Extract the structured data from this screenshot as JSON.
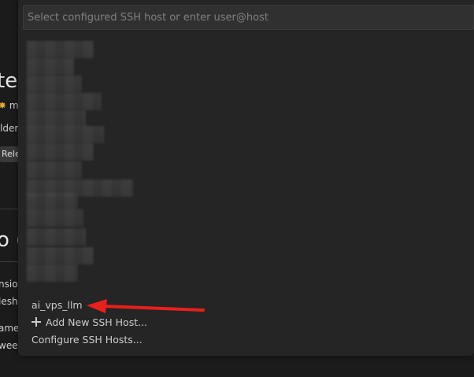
{
  "background": {
    "title_fragment": "te",
    "publisher_fragment": "mi",
    "line_fragment": "lder",
    "release_fragment": "Rele",
    "big_fragment": "o (",
    "row_fragments": [
      "nsio",
      "lesh",
      "ame",
      "wee"
    ]
  },
  "quick_pick": {
    "placeholder": "Select configured SSH host or enter user@host",
    "items": {
      "host": "ai_vps_llm",
      "add_new": "Add New SSH Host...",
      "configure": "Configure SSH Hosts..."
    }
  },
  "annotation": {
    "arrow_color": "#e8201c"
  },
  "colors": {
    "panel": "#252526",
    "input": "#303031",
    "text": "#cccccc"
  }
}
